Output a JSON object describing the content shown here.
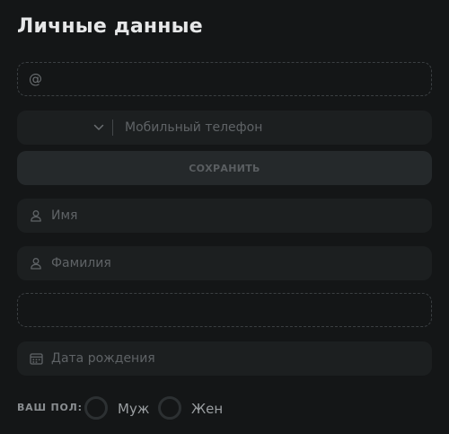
{
  "page": {
    "title": "Личные данные"
  },
  "email": {
    "prefix": "@",
    "value": ""
  },
  "phone": {
    "placeholder": "Мобильный телефон"
  },
  "save": {
    "label": "СОХРАНИТЬ"
  },
  "first_name": {
    "placeholder": "Имя",
    "icon": "user-icon"
  },
  "last_name": {
    "placeholder": "Фамилия",
    "icon": "user-icon"
  },
  "extra_field": {
    "value": ""
  },
  "birth_date": {
    "placeholder": "Дата рождения",
    "icon": "calendar-icon"
  },
  "gender": {
    "label": "ВАШ ПОЛ:",
    "options": [
      {
        "label": "Муж",
        "selected": false
      },
      {
        "label": "Жен",
        "selected": false
      }
    ]
  },
  "colors": {
    "background": "#141617",
    "field_background": "#1c1f20",
    "button_background": "#25292b",
    "title": "#e6e7e8"
  }
}
